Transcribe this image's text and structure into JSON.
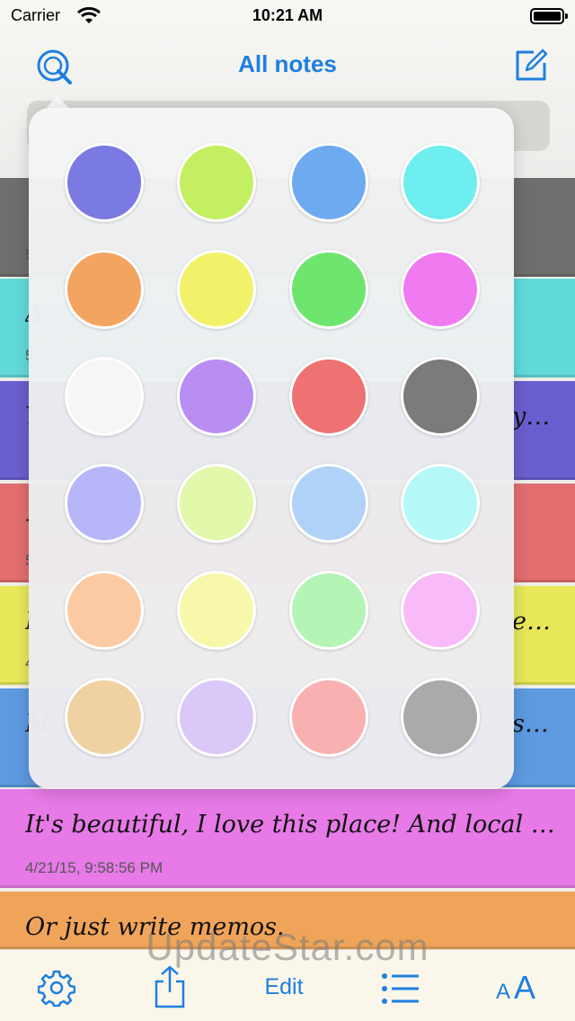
{
  "status_bar": {
    "carrier": "Carrier",
    "time": "10:21 AM"
  },
  "nav": {
    "title": "All notes",
    "search_icon": "search-icon",
    "compose_icon": "compose-icon"
  },
  "notes": [
    {
      "color": "#6e6e6e",
      "text": "",
      "date": "5"
    },
    {
      "color": "#62dada",
      "text": "A",
      "date": "5"
    },
    {
      "color": "#6a5fce",
      "text": "Y",
      "tail": "y…",
      "date": ""
    },
    {
      "color": "#e26e6e",
      "text": "–",
      "date": "5"
    },
    {
      "color": "#e8e85a",
      "text": "I",
      "tail": "e…",
      "date": "4"
    },
    {
      "color": "#5d9ae0",
      "text": "M",
      "tail": "s…",
      "date": ""
    },
    {
      "color": "#e77ae7",
      "text": "It's beautiful, I love this place! And local cuisine i...",
      "date": "4/21/15, 9:58:56 PM"
    },
    {
      "color": "#f0a45a",
      "text": "Or just write memos.",
      "date": ""
    }
  ],
  "palette": {
    "colors": [
      [
        "#7a7ae2",
        "#c4ef62",
        "#6eaaf0",
        "#6eeeee"
      ],
      [
        "#f3a460",
        "#f2f26a",
        "#6ee66e",
        "#f07af0"
      ],
      [
        "#f6f6f6",
        "#b98ef2",
        "#ee7272",
        "#7b7b7b"
      ],
      [
        "#b6b6f8",
        "#e2f8aa",
        "#b0d2f8",
        "#b4f8f8"
      ],
      [
        "#fccaa2",
        "#f8f8aa",
        "#b4f4b4",
        "#f8baf8"
      ],
      [
        "#f0d2a2",
        "#dac8f8",
        "#f8b0b0",
        "#aaaaaa"
      ]
    ]
  },
  "toolbar": {
    "settings_icon": "gear-icon",
    "share_icon": "share-icon",
    "edit_label": "Edit",
    "list_icon": "list-icon",
    "font_small": "A",
    "font_big": "A"
  },
  "watermark": "UpdateStar.com"
}
